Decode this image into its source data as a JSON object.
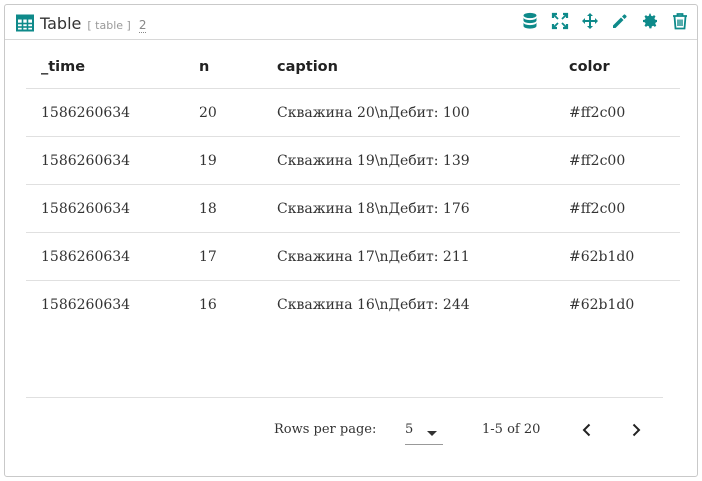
{
  "widget": {
    "title": "Table",
    "type_label": "[ table ]",
    "count": "2"
  },
  "toolbar": {
    "icons": [
      "database-icon",
      "fullscreen-icon",
      "move-icon",
      "edit-icon",
      "settings-icon",
      "delete-icon"
    ],
    "accent_color": "#0e8a8a"
  },
  "table": {
    "columns": [
      "_time",
      "n",
      "caption",
      "color"
    ],
    "rows": [
      {
        "time": "1586260634",
        "n": "20",
        "caption": "Скважина 20\\nДебит: 100",
        "color": "#ff2c00"
      },
      {
        "time": "1586260634",
        "n": "19",
        "caption": "Скважина 19\\nДебит: 139",
        "color": "#ff2c00"
      },
      {
        "time": "1586260634",
        "n": "18",
        "caption": "Скважина 18\\nДебит: 176",
        "color": "#ff2c00"
      },
      {
        "time": "1586260634",
        "n": "17",
        "caption": "Скважина 17\\nДебит: 211",
        "color": "#62b1d0"
      },
      {
        "time": "1586260634",
        "n": "16",
        "caption": "Скважина 16\\nДебит: 244",
        "color": "#62b1d0"
      }
    ]
  },
  "pagination": {
    "rows_per_page_label": "Rows per page:",
    "rows_per_page_value": "5",
    "range": "1-5 of 20"
  }
}
